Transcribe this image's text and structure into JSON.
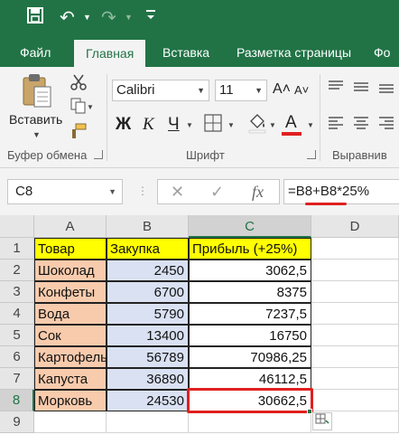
{
  "title_bar": {
    "save_icon": "save-icon",
    "undo_icon": "undo-icon",
    "redo_icon": "redo-icon",
    "customize_icon": "customize-icon"
  },
  "tabs": [
    {
      "label": "Файл",
      "active": false
    },
    {
      "label": "Главная",
      "active": true
    },
    {
      "label": "Вставка",
      "active": false
    },
    {
      "label": "Разметка страницы",
      "active": false
    },
    {
      "label": "Фо",
      "active": false
    }
  ],
  "ribbon": {
    "paste_label": "Вставить",
    "clipboard_group": "Буфер обмена",
    "font_group": "Шрифт",
    "align_group": "Выравнив",
    "font_name": "Calibri",
    "font_size": "11",
    "bold_label": "Ж",
    "italic_label": "К",
    "underline_label": "Ч",
    "font_color_label": "А",
    "grow_font": "A˄",
    "shrink_font": "A˅",
    "font_color": "#e02020"
  },
  "formula_bar": {
    "name_box": "C8",
    "formula": "=B8+B8*25%",
    "cancel_icon": "✕",
    "enter_icon": "✓",
    "fx_label": "fx"
  },
  "grid": {
    "columns": [
      "A",
      "B",
      "C",
      "D"
    ],
    "selected_column": "C",
    "rows": [
      "1",
      "2",
      "3",
      "4",
      "5",
      "6",
      "7",
      "8",
      "9"
    ],
    "selected_row": "8",
    "header": [
      "Товар",
      "Закупка",
      "Прибыль (+25%)"
    ],
    "data": [
      [
        "Шоколад",
        "2450",
        "3062,5"
      ],
      [
        "Конфеты",
        "6700",
        "8375"
      ],
      [
        "Вода",
        "5790",
        "7237,5"
      ],
      [
        "Сок",
        "13400",
        "16750"
      ],
      [
        "Картофель",
        "56789",
        "70986,25"
      ],
      [
        "Капуста",
        "36890",
        "46112,5"
      ],
      [
        "Морковь",
        "24530",
        "30662,5"
      ]
    ],
    "colors": {
      "header_fill": "#ffff00",
      "product_fill": "#f8cbad",
      "purchase_fill": "#d9e1f2",
      "selection_outline": "#e02020"
    }
  }
}
